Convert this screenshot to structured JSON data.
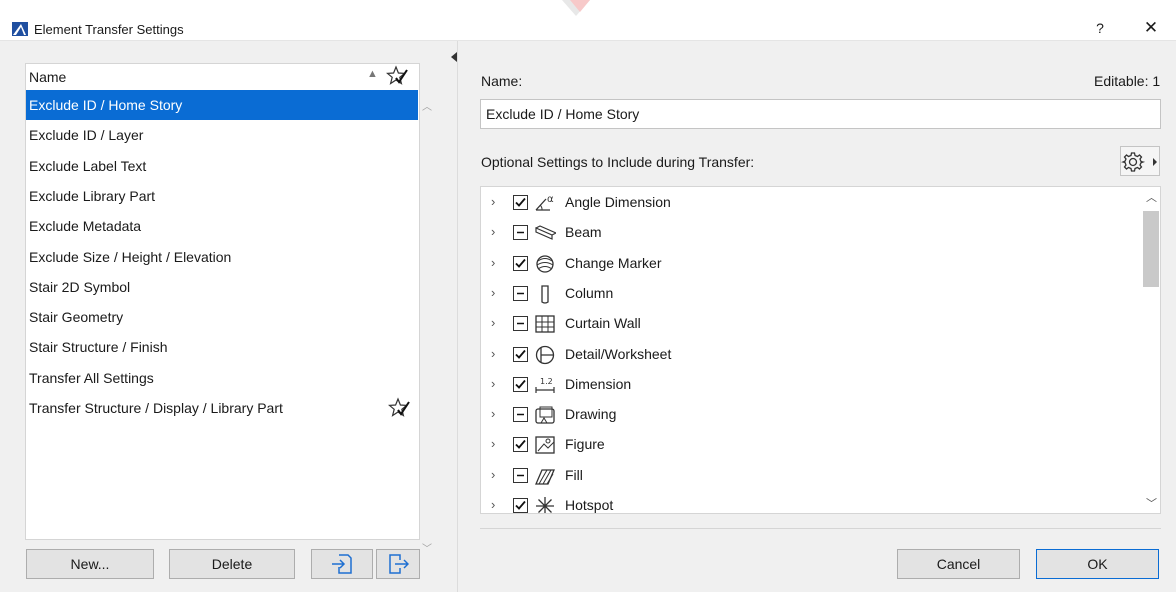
{
  "window": {
    "title": "Element Transfer Settings",
    "help_label": "?",
    "close_label": "✕"
  },
  "list": {
    "column_name": "Name",
    "items": [
      {
        "label": "Exclude ID / Home Story",
        "selected": true,
        "favorite": false
      },
      {
        "label": "Exclude ID / Layer",
        "selected": false,
        "favorite": false
      },
      {
        "label": "Exclude Label Text",
        "selected": false,
        "favorite": false
      },
      {
        "label": "Exclude Library Part",
        "selected": false,
        "favorite": false
      },
      {
        "label": "Exclude Metadata",
        "selected": false,
        "favorite": false
      },
      {
        "label": "Exclude Size / Height / Elevation",
        "selected": false,
        "favorite": false
      },
      {
        "label": "Stair 2D Symbol",
        "selected": false,
        "favorite": false
      },
      {
        "label": "Stair Geometry",
        "selected": false,
        "favorite": false
      },
      {
        "label": "Stair Structure / Finish",
        "selected": false,
        "favorite": false
      },
      {
        "label": "Transfer All Settings",
        "selected": false,
        "favorite": false
      },
      {
        "label": "Transfer Structure / Display / Library Part",
        "selected": false,
        "favorite": true
      }
    ]
  },
  "buttons": {
    "new": "New...",
    "delete": "Delete",
    "cancel": "Cancel",
    "ok": "OK"
  },
  "detail": {
    "name_label": "Name:",
    "editable_label": "Editable: 1",
    "name_value": "Exclude ID / Home Story",
    "optional_label": "Optional Settings to Include during Transfer:"
  },
  "tree": [
    {
      "label": "Angle Dimension",
      "state": "checked",
      "icon": "angle-dimension-icon"
    },
    {
      "label": "Beam",
      "state": "partial",
      "icon": "beam-icon"
    },
    {
      "label": "Change Marker",
      "state": "checked",
      "icon": "change-marker-icon"
    },
    {
      "label": "Column",
      "state": "partial",
      "icon": "column-icon"
    },
    {
      "label": "Curtain Wall",
      "state": "partial",
      "icon": "curtain-wall-icon"
    },
    {
      "label": "Detail/Worksheet",
      "state": "checked",
      "icon": "detail-worksheet-icon"
    },
    {
      "label": "Dimension",
      "state": "checked",
      "icon": "dimension-icon",
      "icon_text": "1.2"
    },
    {
      "label": "Drawing",
      "state": "partial",
      "icon": "drawing-icon"
    },
    {
      "label": "Figure",
      "state": "checked",
      "icon": "figure-icon"
    },
    {
      "label": "Fill",
      "state": "partial",
      "icon": "fill-icon"
    },
    {
      "label": "Hotspot",
      "state": "checked",
      "icon": "hotspot-icon"
    }
  ],
  "colors": {
    "selection": "#0a6cd4",
    "ok_border": "#0a6cd4"
  }
}
